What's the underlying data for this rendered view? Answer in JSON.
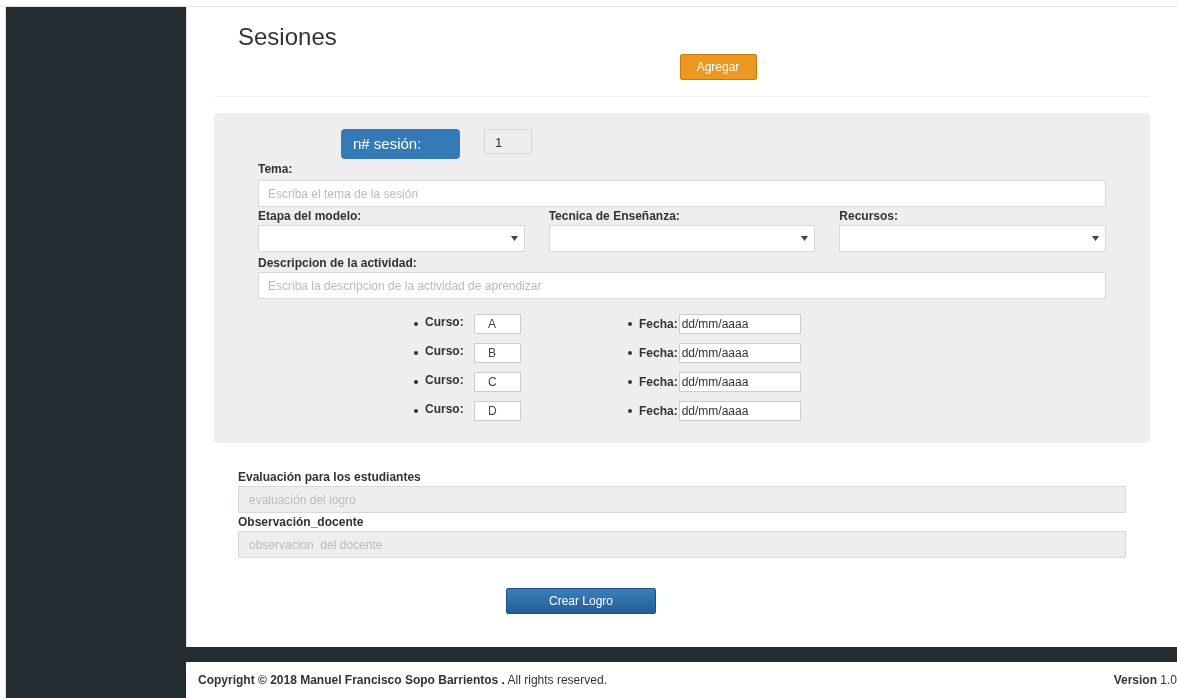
{
  "page": {
    "title": "Sesiones",
    "add_button": "Agregar"
  },
  "session": {
    "label": "n# sesión:",
    "number": "1"
  },
  "topic": {
    "label": "Tema:",
    "placeholder": "Escriba el tema de la sesión"
  },
  "selects": [
    {
      "label": "Etapa del modelo:"
    },
    {
      "label": "Tecnica de Enseñanza:"
    },
    {
      "label": "Recursos:"
    }
  ],
  "activity": {
    "label": "Descripcion de la actividad:",
    "placeholder": "Escriba la descripcion de la actividad de aprendizar"
  },
  "courses": [
    {
      "course_label": "Curso:",
      "course": "A",
      "date_label": "Fecha:",
      "date": "dd/mm/aaaa"
    },
    {
      "course_label": "Curso:",
      "course": "B",
      "date_label": "Fecha:",
      "date": "dd/mm/aaaa"
    },
    {
      "course_label": "Curso:",
      "course": "C",
      "date_label": "Fecha:",
      "date": "dd/mm/aaaa"
    },
    {
      "course_label": "Curso:",
      "course": "D",
      "date_label": "Fecha:",
      "date": "dd/mm/aaaa"
    }
  ],
  "evaluation": {
    "label": "Evaluación para los estudiantes",
    "placeholder": "evaluación del logro"
  },
  "observation": {
    "label": "Observación_docente",
    "placeholder": "observacion  del docente"
  },
  "submit_button": "Crear Logro",
  "footer": {
    "copyright": "**Copyright © 2018 Manuel Francisco Sopo Barrientos .** All rights reserved.",
    "version": "**Version** 1.0"
  }
}
